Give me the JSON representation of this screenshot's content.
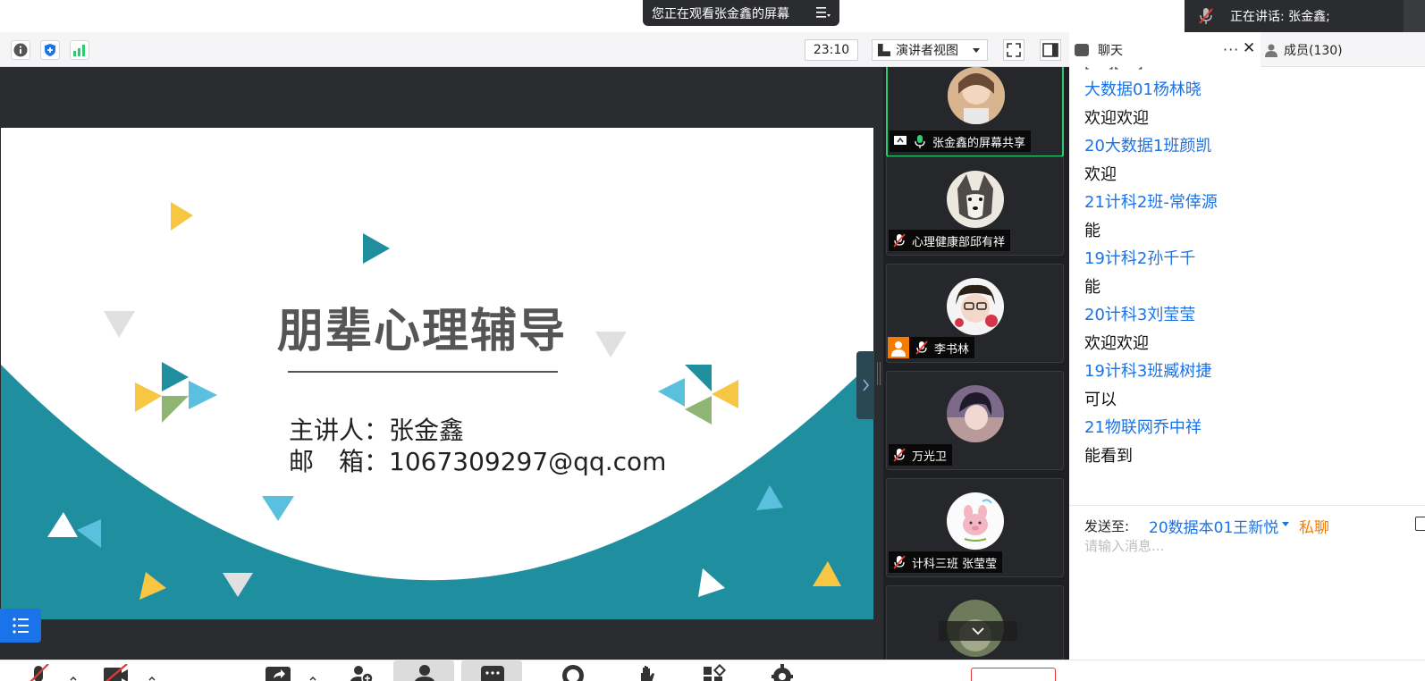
{
  "top": {
    "viewing_text": "您正在观看张金鑫的屏幕",
    "speaking_text": "正在讲话: 张金鑫;"
  },
  "toolbar": {
    "timer": "23:10",
    "view_mode": "演讲者视图"
  },
  "slide": {
    "title": "朋辈心理辅导",
    "presenter_label": "主讲人：",
    "presenter_value": "张金鑫",
    "email_label": "邮　箱：",
    "email_value": "1067309297@qq.com"
  },
  "gallery": {
    "tiles": [
      {
        "name": "张金鑫的屏幕共享",
        "mic": "mic-on",
        "active": true
      },
      {
        "name": "心理健康部邱有祥",
        "mic": "mic-muted"
      },
      {
        "name": "李书林",
        "mic": "mic-muted",
        "badge": "avatar-badge"
      },
      {
        "name": "万光卫",
        "mic": "mic-muted"
      },
      {
        "name": "计科三班 张莹莹",
        "mic": "mic-muted"
      }
    ]
  },
  "chat": {
    "tab_label": "聊天",
    "members_label": "成员(130)",
    "messages": [
      {
        "sender": "大数据01杨林晓",
        "text": "欢迎欢迎"
      },
      {
        "sender": "20大数据1班颜凯",
        "text": "欢迎"
      },
      {
        "sender": "21计科2班-常倖源",
        "text": "能"
      },
      {
        "sender": "19计科2孙千千",
        "text": "能"
      },
      {
        "sender": "20计科3刘莹莹",
        "text": "欢迎欢迎"
      },
      {
        "sender": "19计科3班臧树捷",
        "text": "可以"
      },
      {
        "sender": "21物联网乔中祥",
        "text": "能看到"
      }
    ],
    "send_to_label": "发送至:",
    "send_to_target": "20数据本01王新悦",
    "private_label": "私聊",
    "input_placeholder": "请输入消息..."
  },
  "colors": {
    "teal": "#1f8fa0",
    "link_blue": "#1a73e8",
    "private_orange": "#f57c00",
    "active_green": "#2ecc71"
  }
}
